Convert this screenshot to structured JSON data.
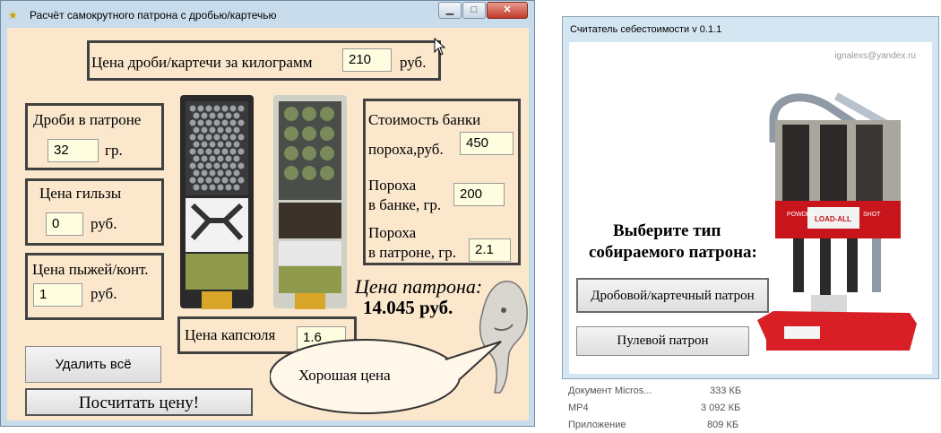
{
  "background_list": [
    {
      "name": "Документ Micros...",
      "size": "333 КБ"
    },
    {
      "name": "MP4",
      "size": "3 092 КБ"
    },
    {
      "name": "Приложение",
      "size": "809 КБ"
    }
  ],
  "main_window": {
    "title": "Расчёт самокрутного патрона с дробью/картечью",
    "controls": {
      "minimize": "▁",
      "maximize": "□",
      "close": "✕"
    },
    "shot_price": {
      "label": "Цена дроби/картечи за килограмм",
      "value": "210",
      "unit": "руб."
    },
    "shot_in_shell": {
      "label": "Дроби в патроне",
      "value": "32",
      "unit": "гр."
    },
    "case_price": {
      "label": "Цена гильзы",
      "value": "0",
      "unit": "руб."
    },
    "wad_price": {
      "label": "Цена пыжей/конт.",
      "value": "1",
      "unit": "руб."
    },
    "powder": {
      "can_cost_label_1": "Стоимость банки",
      "can_cost_label_2": "пороха,руб.",
      "can_cost_value": "450",
      "in_can_label_1": "Пороха",
      "in_can_label_2": "в банке, гр.",
      "in_can_value": "200",
      "in_shell_label_1": "Пороха",
      "in_shell_label_2": "в патроне, гр.",
      "in_shell_value": "2.1"
    },
    "primer": {
      "label": "Цена капсюля",
      "value": "1.6"
    },
    "result": {
      "label": "Цена патрона:",
      "value": "14.045 руб."
    },
    "speech": "Хорошая цена",
    "clear_button": "Удалить всё",
    "calc_button": "Посчитать цену!"
  },
  "cost_window": {
    "title": "Считатель себестоимости v 0.1.1",
    "author": "ignalexs@yandex.ru",
    "heading_1": "Выберите тип",
    "heading_2": "собираемого патрона:",
    "shot_button": "Дробовой/картечный патрон",
    "bullet_button": "Пулевой патрон",
    "press_labels": {
      "powder": "POWDER",
      "shot": "SHOT",
      "brand": "LOAD-ALL"
    }
  },
  "colors": {
    "client_bg": "#fbe7cc",
    "input_bg": "#fffde0",
    "box_border": "#414141",
    "press_red": "#c8141b"
  }
}
